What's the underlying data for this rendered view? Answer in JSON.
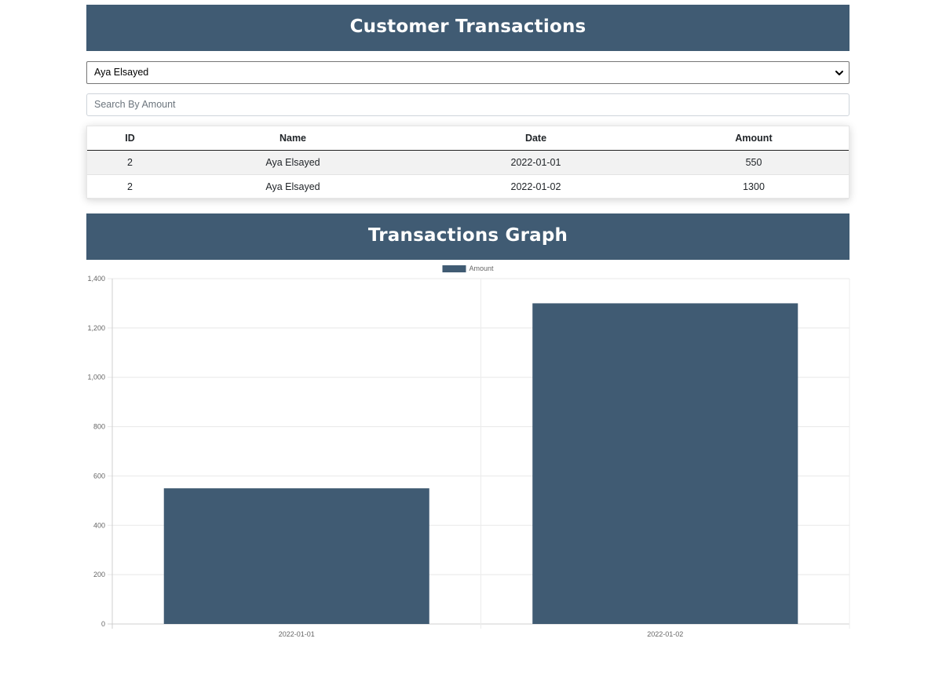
{
  "header": {
    "title": "Customer Transactions"
  },
  "customer_select": {
    "selected": "Aya Elsayed"
  },
  "search": {
    "placeholder": "Search By Amount"
  },
  "table": {
    "columns": [
      "ID",
      "Name",
      "Date",
      "Amount"
    ],
    "rows": [
      [
        "2",
        "Aya Elsayed",
        "2022-01-01",
        "550"
      ],
      [
        "2",
        "Aya Elsayed",
        "2022-01-02",
        "1300"
      ]
    ]
  },
  "graph_header": {
    "title": "Transactions Graph"
  },
  "colors": {
    "banner": "#405b73",
    "bar": "#405b73"
  },
  "chart_data": {
    "type": "bar",
    "categories": [
      "2022-01-01",
      "2022-01-02"
    ],
    "series": [
      {
        "name": "Amount",
        "values": [
          550,
          1300
        ]
      }
    ],
    "ylim": [
      0,
      1400
    ],
    "yticks": [
      0,
      200,
      400,
      600,
      800,
      1000,
      1200,
      1400
    ],
    "ytick_labels": [
      "0",
      "200",
      "400",
      "600",
      "800",
      "1,000",
      "1,200",
      "1,400"
    ],
    "legend": "top-center",
    "grid": true
  }
}
